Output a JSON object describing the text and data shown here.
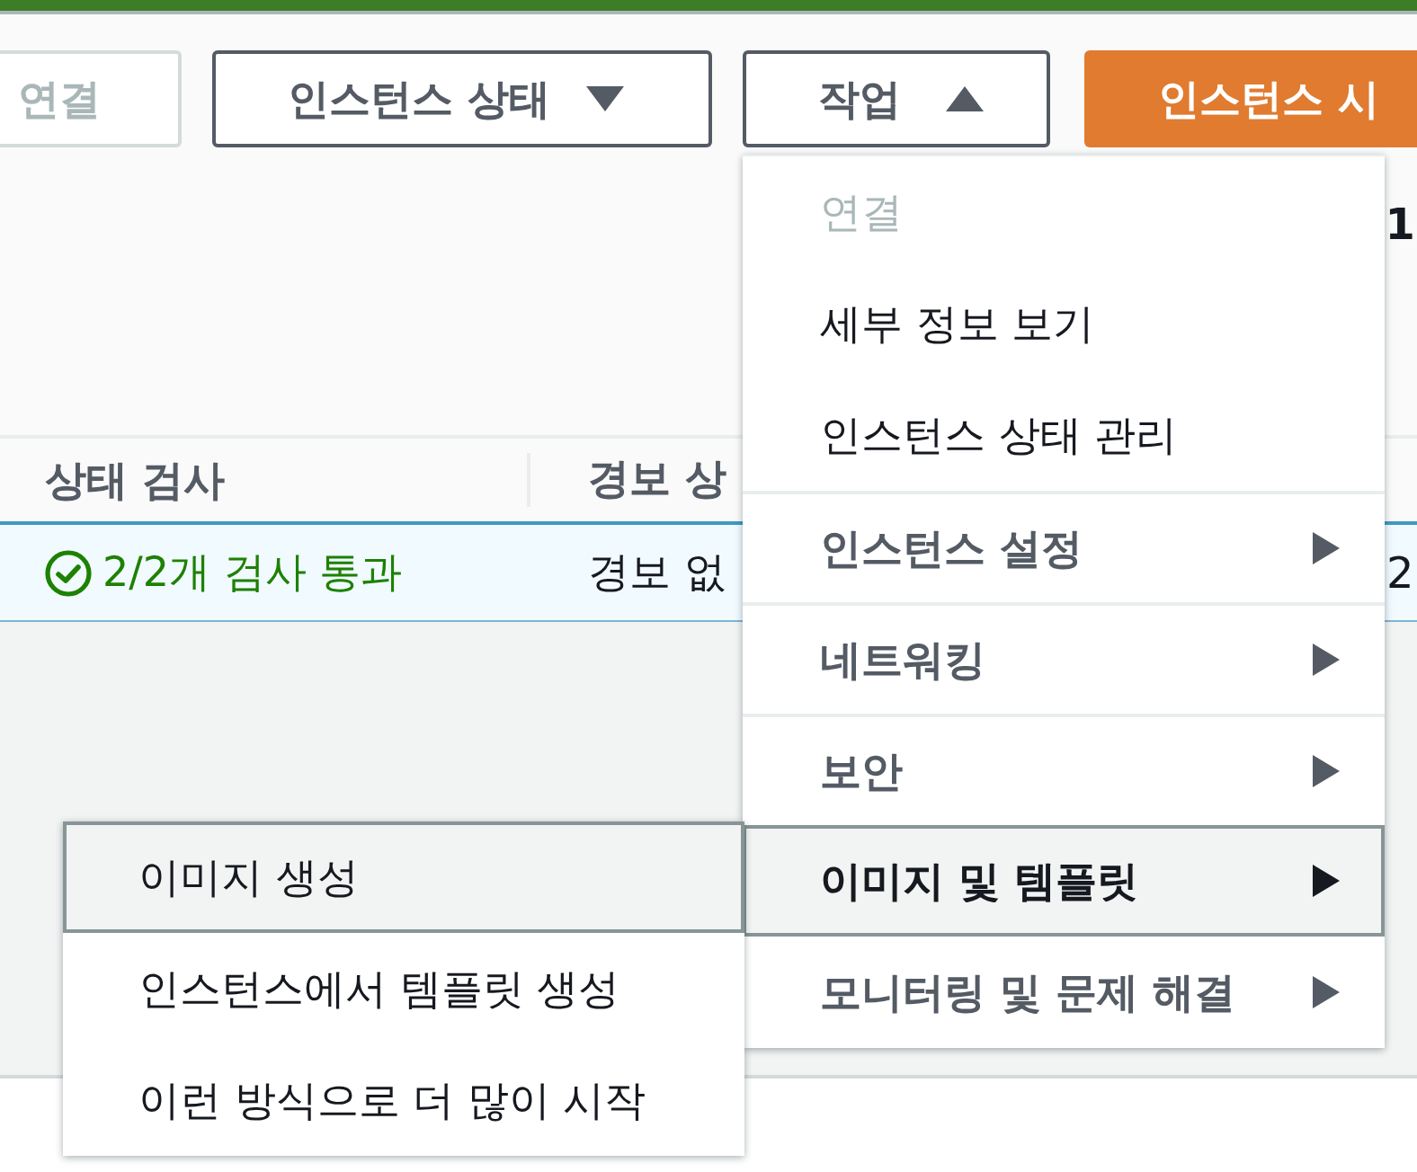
{
  "toolbar": {
    "buttons": [
      {
        "label": "연결",
        "kind": "plain",
        "disabled": true
      },
      {
        "label": "인스턴스 상태",
        "kind": "dropdown",
        "disabled": false,
        "expanded": false
      },
      {
        "label": "작업",
        "kind": "dropdown",
        "disabled": false,
        "expanded": true
      },
      {
        "label": "인스턴스 시",
        "kind": "primary",
        "disabled": false
      }
    ]
  },
  "pagination": {
    "page": "1"
  },
  "table": {
    "columns": [
      "상태 검사",
      "경보 상"
    ],
    "rows": [
      {
        "selected": true,
        "cells": [
          {
            "kind": "status",
            "text": "2/2개 검사 통과"
          },
          {
            "kind": "text",
            "text": "경보 없"
          },
          {
            "kind": "text",
            "text": "2"
          }
        ]
      }
    ]
  },
  "actions_menu": {
    "items": [
      {
        "label": "연결",
        "kind": "action",
        "disabled": true
      },
      {
        "label": "세부 정보 보기",
        "kind": "action",
        "disabled": false
      },
      {
        "label": "인스턴스 상태 관리",
        "kind": "action",
        "disabled": false
      },
      {
        "label": "인스턴스 설정",
        "kind": "submenu",
        "disabled": false,
        "expanded": false
      },
      {
        "label": "네트워킹",
        "kind": "submenu",
        "disabled": false,
        "expanded": false
      },
      {
        "label": "보안",
        "kind": "submenu",
        "disabled": false,
        "expanded": false
      },
      {
        "label": "이미지 및 템플릿",
        "kind": "submenu",
        "disabled": false,
        "expanded": true
      },
      {
        "label": "모니터링 및 문제 해결",
        "kind": "submenu",
        "disabled": false,
        "expanded": false
      }
    ]
  },
  "submenu": {
    "items": [
      {
        "label": "이미지 생성",
        "highlighted": true
      },
      {
        "label": "인스턴스에서 템플릿 생성",
        "highlighted": false
      },
      {
        "label": "이런 방식으로 더 많이 시작",
        "highlighted": false
      }
    ]
  }
}
